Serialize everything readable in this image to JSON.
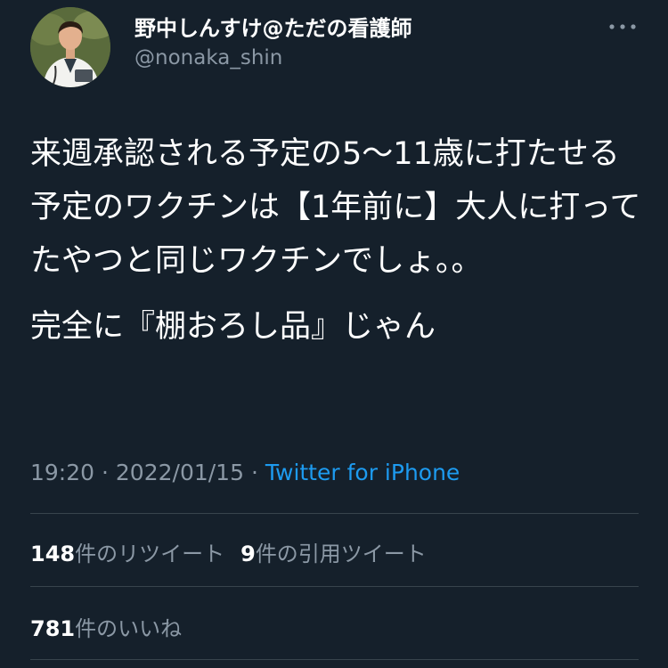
{
  "tweet": {
    "author": {
      "display_name": "野中しんすけ@ただの看護師",
      "handle": "@nonaka_shin"
    },
    "body_paragraphs": [
      "来週承認される予定の5〜11歳に打たせる予定のワクチンは【1年前に】大人に打ってたやつと同じワクチンでしょ。。",
      "完全に『棚おろし品』じゃん"
    ],
    "time": "19:20",
    "separator": "·",
    "date": "2022/01/15",
    "source": "Twitter for iPhone",
    "stats": {
      "retweets_count": "148",
      "retweets_label": "件のリツイート",
      "quotes_count": "9",
      "quotes_label": "件の引用ツイート",
      "likes_count": "781",
      "likes_label": "件のいいね"
    }
  },
  "icons": {
    "more": "more-horizontal-icon",
    "avatar": "profile-photo"
  },
  "colors": {
    "background": "#15202b",
    "primary_text": "#ffffff",
    "secondary_text": "#8b98a5",
    "link": "#1d9bf0",
    "divider": "#38444d"
  }
}
